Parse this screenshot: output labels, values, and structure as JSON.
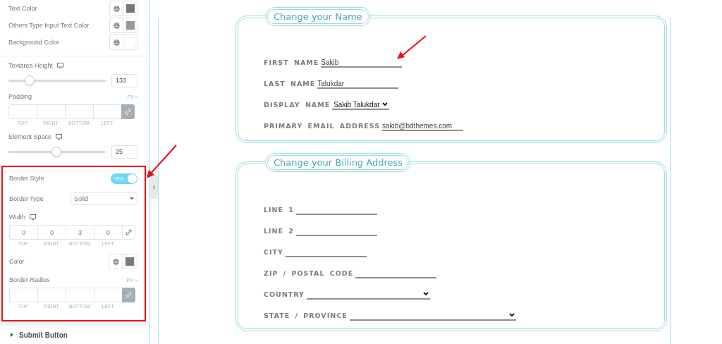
{
  "panel": {
    "color_rows": [
      {
        "label": "Text Color",
        "color": "#777777"
      },
      {
        "label": "Others Type Input Text Color",
        "color": "#999999"
      },
      {
        "label": "Background Color",
        "color": "#ffffff"
      }
    ],
    "controls": [
      {
        "kind": "slider",
        "label": "Textarea Height",
        "responsive": true,
        "level": 0.22,
        "value": "133"
      },
      {
        "kind": "dimensions",
        "label": "Padding",
        "unit": "PX",
        "linked": true,
        "fields": [
          {
            "caption": "TOP"
          },
          {
            "caption": "RIGHT"
          },
          {
            "caption": "BOTTOM"
          },
          {
            "caption": "LEFT"
          }
        ]
      },
      {
        "kind": "slider",
        "label": "Element Space",
        "responsive": true,
        "level": 0.49,
        "value": "25"
      }
    ],
    "highlighted_controls": [
      {
        "kind": "toggle",
        "label": "Border Style",
        "on": true,
        "text": "YES"
      },
      {
        "kind": "select",
        "label": "Border Type",
        "value": "Solid"
      },
      {
        "kind": "dimensions",
        "label": "Width",
        "responsive": true,
        "linked": false,
        "fields": [
          {
            "caption": "TOP",
            "value": "0"
          },
          {
            "caption": "RIGHT",
            "value": "0"
          },
          {
            "caption": "BOTTOM",
            "value": "3"
          },
          {
            "caption": "LEFT",
            "value": "0"
          }
        ]
      },
      {
        "kind": "color",
        "label": "Color",
        "color": "#7a7a7a"
      },
      {
        "kind": "dimensions",
        "label": "Border Radius",
        "unit": "PX",
        "linked": true,
        "fields": [
          {
            "caption": "TOP"
          },
          {
            "caption": "RIGHT"
          },
          {
            "caption": "BOTTOM"
          },
          {
            "caption": "LEFT"
          }
        ]
      }
    ],
    "sections": [
      {
        "label": "Submit Button",
        "expanded": false
      }
    ]
  },
  "form": {
    "fieldsets": [
      {
        "legend": "Change your Name",
        "fields": [
          {
            "label": "FIRST NAME",
            "kind": "text",
            "value": "Sakib"
          },
          {
            "label": "LAST NAME",
            "kind": "text",
            "value": "Talukdar"
          },
          {
            "label": "DISPLAY NAME",
            "kind": "select",
            "value": "Sakib Talukdar"
          },
          {
            "label": "PRIMARY EMAIL ADDRESS",
            "kind": "text",
            "value": "sakib@bdthemes.com"
          }
        ]
      },
      {
        "legend": "Change your Billing Address",
        "fields": [
          {
            "label": "LINE 1",
            "kind": "text"
          },
          {
            "label": "LINE 2",
            "kind": "text"
          },
          {
            "label": "CITY",
            "kind": "text"
          },
          {
            "label": "ZIP / POSTAL CODE",
            "kind": "text"
          },
          {
            "label": "COUNTRY",
            "kind": "select"
          },
          {
            "label": "STATE / PROVINCE",
            "kind": "select"
          }
        ]
      }
    ]
  }
}
